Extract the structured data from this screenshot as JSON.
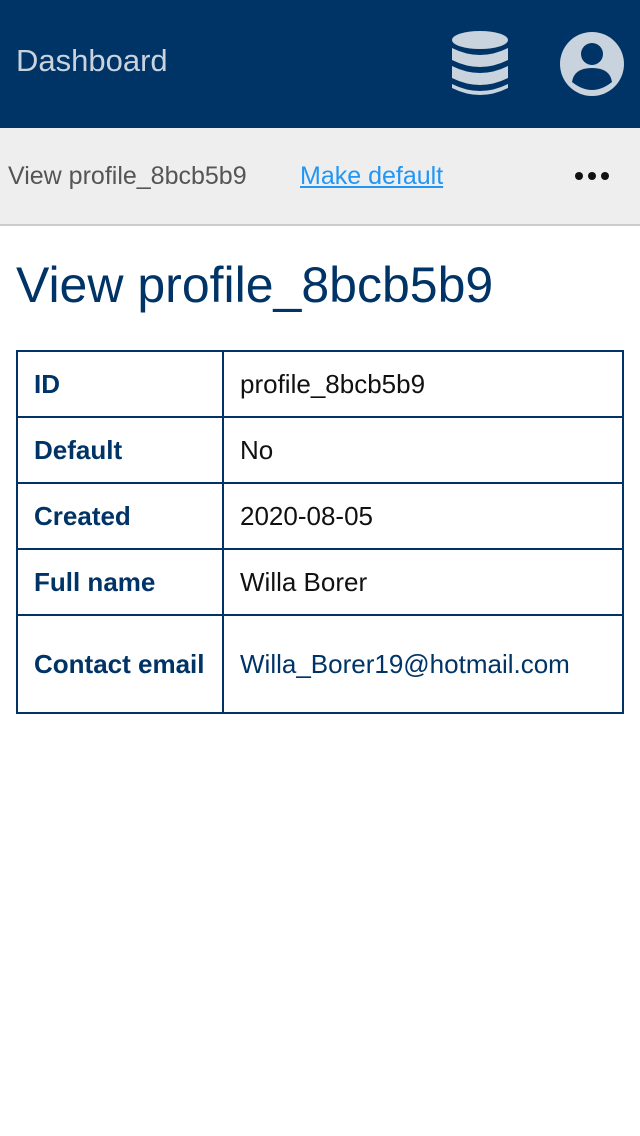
{
  "header": {
    "brand": "Dashboard",
    "icons": [
      "database-icon",
      "user-account-icon"
    ],
    "background_color": "#003366"
  },
  "toolbar": {
    "breadcrumb": "View profile_8bcb5b9",
    "make_default_label": "Make default",
    "more_icon": "ellipsis-icon"
  },
  "main": {
    "title": "View profile_8bcb5b9",
    "rows": [
      {
        "label": "ID",
        "value": "profile_8bcb5b9"
      },
      {
        "label": "Default",
        "value": "No"
      },
      {
        "label": "Created",
        "value": "2020-08-05"
      },
      {
        "label": "Full name",
        "value": "Willa Borer"
      },
      {
        "label": "Contact email",
        "value": "Willa_Borer19@hotmail.com"
      }
    ]
  }
}
